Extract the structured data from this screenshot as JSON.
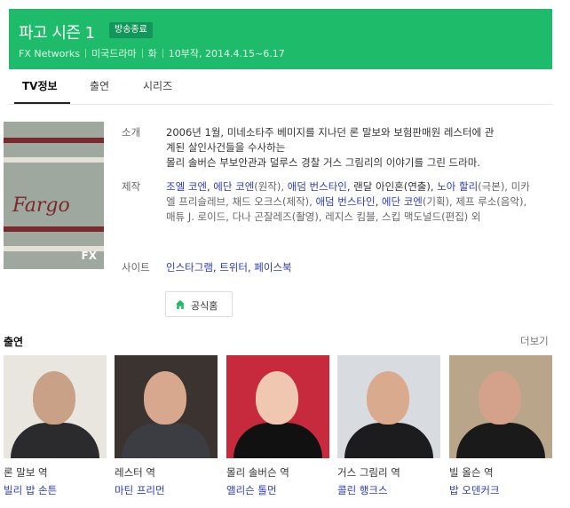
{
  "header": {
    "title": "파고 시즌 1",
    "badge": "방송종료",
    "network": "FX Networks",
    "genre": "미국드라마",
    "day": "화",
    "episodes_dates": "10부작, 2014.4.15~6.17"
  },
  "tabs": [
    {
      "label": "TV정보",
      "active": true
    },
    {
      "label": "출연",
      "active": false
    },
    {
      "label": "시리즈",
      "active": false
    }
  ],
  "poster": {
    "logo_text": "Fargo",
    "network_mark": "FX"
  },
  "info": {
    "synopsis_label": "소개",
    "synopsis_line1": "2006년 1월, 미네소타주 베미지를 지나던 론 말보와 보험판매원 레스터에 관",
    "synopsis_line2": "계된 살인사건들을 수사하는",
    "synopsis_line3": "몰리 솔버슨 부보안관과 덜루스 경찰 거스 그림리의 이야기를 그린 드라마.",
    "production_label": "제작",
    "p1": "조엘 코엔",
    "p2": "에단 코엔",
    "p3": "(원작), ",
    "p4": "애덤 번스타인",
    "p5": ", 랜달 아인혼(연출), ",
    "p6": "노아 할리",
    "p7": "(극본), 미카엘 프리슬레브, 채드 오크스(제작), ",
    "p8": "애덤 번스타인",
    "p9": "에단 코엔",
    "p10": "(기획), 제프 루소(음악), 매튜 J. 로이드, 다나 곤잘레즈(촬영), 레지스 킴블, 스킵 맥도널드(편집) 외",
    "site_label": "사이트",
    "site1": "인스타그램",
    "site2": "트위터",
    "site3": "페이스북"
  },
  "home_button": "공식홈",
  "cast_section": {
    "title": "출연",
    "more": "더보기",
    "members": [
      {
        "role": "론 말보 역",
        "name": "빌리 밥 손튼",
        "bg": "#e9e6df",
        "skin": "#c9a187",
        "suit": "#2b2a2c"
      },
      {
        "role": "레스터 역",
        "name": "마틴 프리먼",
        "bg": "#3a3330",
        "skin": "#d7a88d",
        "suit": "#3c3d42"
      },
      {
        "role": "몰리 솔버슨 역",
        "name": "앨리슨 톨먼",
        "bg": "#c72a3c",
        "skin": "#f0c7b0",
        "suit": "#111111"
      },
      {
        "role": "거스 그림리 역",
        "name": "콜린 행크스",
        "bg": "#d8dbe0",
        "skin": "#d9aa8e",
        "suit": "#1c1c1e"
      },
      {
        "role": "빌 올슨 역",
        "name": "밥 오덴커크",
        "bg": "#b9a58a",
        "skin": "#d4a28b",
        "suit": "#1a1a1b"
      }
    ]
  }
}
